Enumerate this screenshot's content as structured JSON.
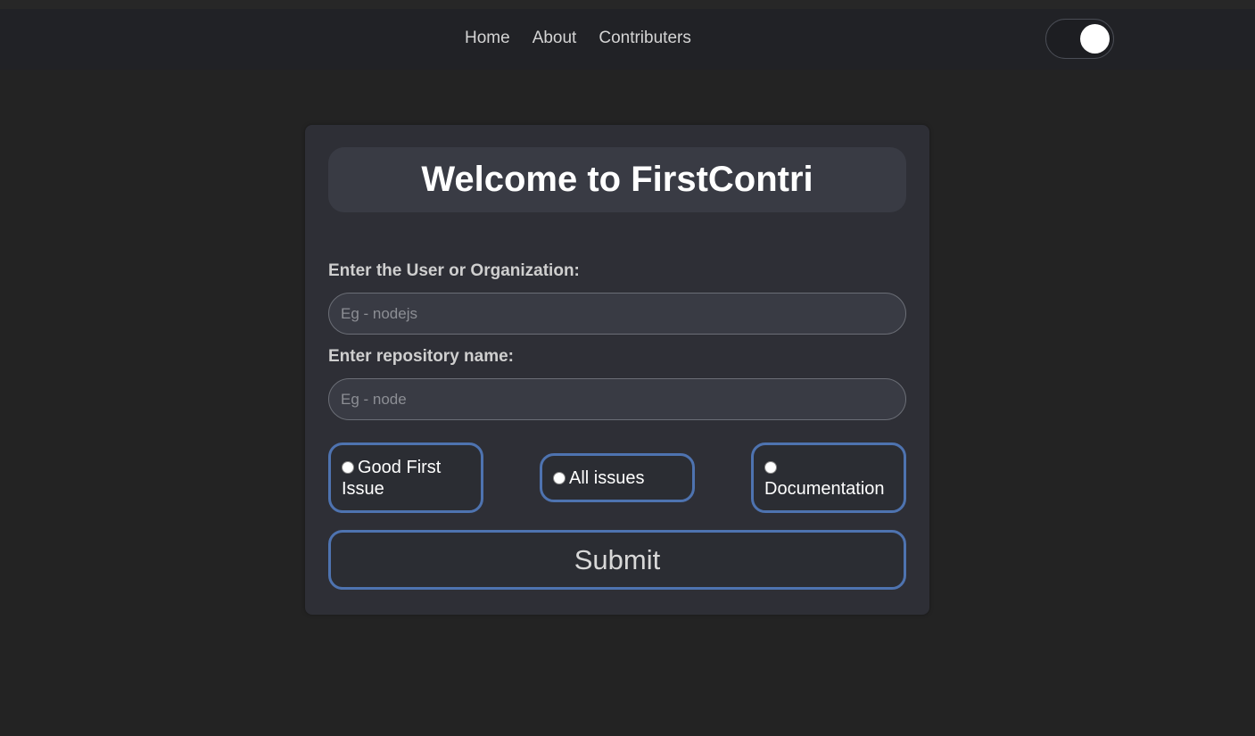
{
  "nav": {
    "links": [
      "Home",
      "About",
      "Contributers"
    ],
    "theme_toggle_state": "on"
  },
  "form": {
    "title": "Welcome to FirstContri",
    "user_label": "Enter the User or Organization:",
    "user_placeholder": "Eg - nodejs",
    "user_value": "",
    "repo_label": "Enter repository name:",
    "repo_placeholder": "Eg - node",
    "repo_value": "",
    "options": [
      {
        "label": "Good First Issue",
        "selected": false
      },
      {
        "label": "All issues",
        "selected": false
      },
      {
        "label": "Documentation",
        "selected": false
      }
    ],
    "submit_label": "Submit"
  },
  "colors": {
    "background": "#232323",
    "navbar": "#212226",
    "card": "#2e2f36",
    "accent_border": "#4e73b0"
  }
}
